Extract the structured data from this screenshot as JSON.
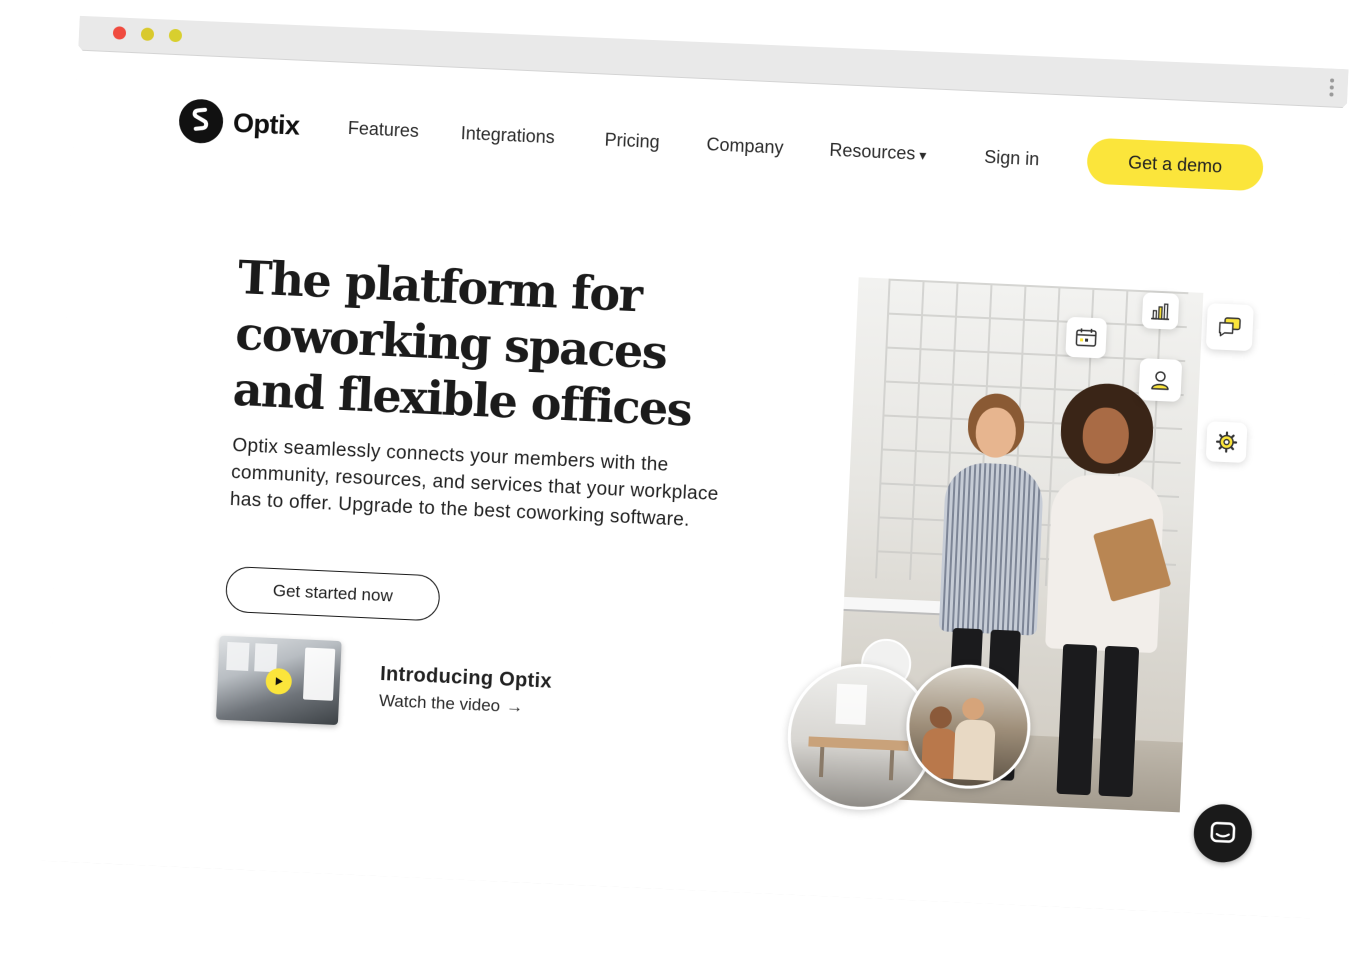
{
  "window": {
    "controls": [
      "close",
      "minimize",
      "maximize"
    ]
  },
  "brand": {
    "name": "Optix",
    "accent_color": "#fbe53b",
    "logo_icon": "optix-logo-icon"
  },
  "nav": {
    "items": [
      {
        "label": "Features"
      },
      {
        "label": "Integrations"
      },
      {
        "label": "Pricing"
      },
      {
        "label": "Company"
      },
      {
        "label": "Resources",
        "icon": "caret-down-icon",
        "caret": "▾"
      }
    ],
    "signin_label": "Sign in",
    "demo_label": "Get a demo"
  },
  "hero": {
    "title": "The platform for coworking spaces and flexible offices",
    "description": "Optix seamlessly connects your members with the community, resources, and services that your workplace has to offer. Upgrade to the best coworking software.",
    "cta_label": "Get started now"
  },
  "video": {
    "title": "Introducing Optix",
    "link_label": "Watch the video",
    "link_arrow": "→",
    "play_icon": "play-icon"
  },
  "feature_icons": [
    "calendar-icon",
    "bar-chart-icon",
    "chat-icon",
    "user-icon",
    "gear-icon"
  ],
  "chat_widget": {
    "icon": "chat-bubble-icon"
  }
}
